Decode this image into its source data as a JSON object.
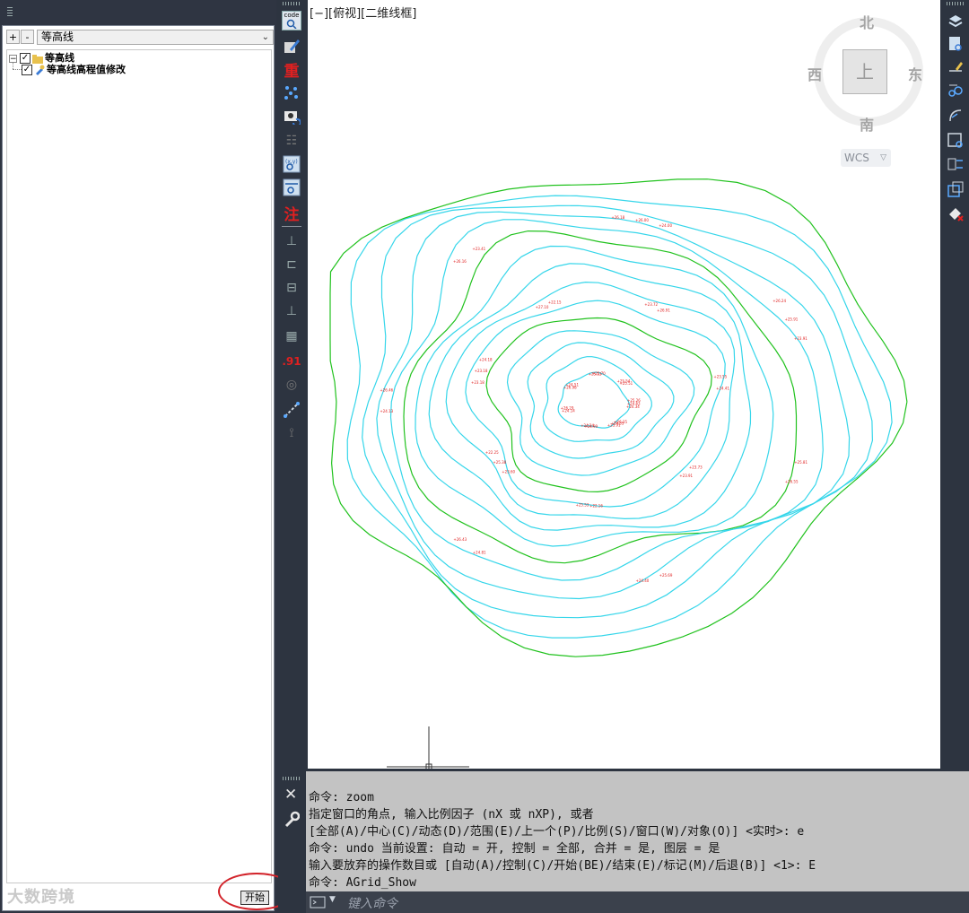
{
  "left_panel": {
    "toolbar": {
      "plus": "+",
      "minus": "-",
      "filter": "等高线"
    },
    "tree": {
      "root": {
        "label": "等高线",
        "expander": "−",
        "checked": true
      },
      "child": {
        "label": "等高线高程值修改",
        "checked": true
      }
    },
    "start_button": "开始",
    "watermark": "大数跨境"
  },
  "left_toolbar": {
    "code_label": "code",
    "zhong_label": "重",
    "zhu_label": "注",
    "num_label": ".91"
  },
  "viewport": {
    "label": "[−][俯视][二维线框]"
  },
  "viewcube": {
    "north": "北",
    "south": "南",
    "east": "东",
    "west": "西",
    "top": "上",
    "wcs": "WCS"
  },
  "command": {
    "history": [
      "命令: zoom",
      "指定窗口的角点, 输入比例因子 (nX 或 nXP), 或者",
      "[全部(A)/中心(C)/动态(D)/范围(E)/上一个(P)/比例(S)/窗口(W)/对象(O)] <实时>: e",
      "命令: undo 当前设置: 自动 = 开, 控制 = 全部, 合并 = 是, 图层 = 是",
      "输入要放弃的操作数目或 [自动(A)/控制(C)/开始(BE)/结束(E)/标记(M)/后退(B)] <1>: E",
      "命令: AGrid_Show"
    ],
    "input_placeholder": "键入命令",
    "close_glyph": "✕"
  },
  "colors": {
    "contour_cyan": "#36d6ea",
    "contour_green": "#21c21e",
    "label_red": "#e01e1e",
    "background": "#2d3440",
    "command_bg": "#c3c3c3"
  },
  "drawing": {
    "elevation_labels": [
      "+25.26",
      "+23.60",
      "+26.18",
      "+26.35",
      "+23.18",
      "+26.24",
      "+24.99",
      "+27.10",
      "+25.81",
      "+24.14",
      "+23.72",
      "+25.69",
      "+26.98",
      "+23.55",
      "+24.81",
      "+25.13",
      "+23.73",
      "+24.13",
      "+25.54",
      "+22.16",
      "+26.16",
      "+24.63",
      "+25.38",
      "+26.00",
      "+24.55",
      "+23.18",
      "+25.91",
      "+24.24",
      "+22.15",
      "+26.55",
      "+26.29",
      "+26.91",
      "+24.40",
      "+24.51",
      "+24.41",
      "+26.43",
      "+25.70",
      "+23.91",
      "+26.46",
      "+25.51",
      "+25.53",
      "+23.41",
      "+24.34",
      "+22.25",
      "+24.00",
      "+25.91",
      "+24.18",
      "+23.91"
    ]
  }
}
